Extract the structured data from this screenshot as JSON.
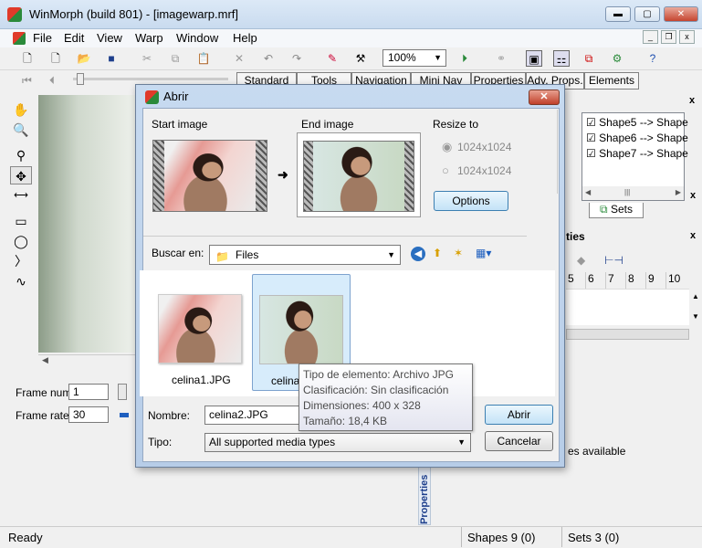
{
  "window": {
    "title": "WinMorph (build 801) - [imagewarp.mrf]",
    "min": "▬",
    "max": "▢",
    "close": "✕"
  },
  "menu": [
    "File",
    "Edit",
    "View",
    "Warp",
    "Window",
    "Help"
  ],
  "mdi": {
    "min": "_",
    "restore": "❐",
    "close": "x"
  },
  "toolbar": {
    "zoom": "100%"
  },
  "tabs": [
    "Standard",
    "Tools",
    "Navigation",
    "Mini Nav",
    "Properties",
    "Adv. Props.",
    "Elements"
  ],
  "left": {
    "frame_num_label": "Frame num",
    "frame_num_value": "1",
    "frame_rate_label": "Frame rate",
    "frame_rate_value": "30"
  },
  "shapes": [
    "Shape5 --> Shape",
    "Shape6 --> Shape",
    "Shape7 --> Shape"
  ],
  "sets_tab": "Sets",
  "panel2": {
    "title": "ties",
    "ticks": [
      "5",
      "6",
      "7",
      "8",
      "9",
      "10"
    ]
  },
  "status": {
    "ready": "Ready",
    "shapes": "Shapes 9 (0)",
    "sets": "Sets 3 (0)",
    "available": "es available"
  },
  "properties_vertical": "Properties",
  "dialog": {
    "title": "Abrir",
    "start_label": "Start image",
    "end_label": "End image",
    "resize_label": "Resize to",
    "resize_opt1": "1024x1024",
    "resize_opt2": "1024x1024",
    "options_btn": "Options",
    "lookin_label": "Buscar en:",
    "lookin_value": "Files",
    "files": [
      {
        "name": "celina1.JPG"
      },
      {
        "name": "celina2.JPG"
      }
    ],
    "file2_visible": "celina",
    "name_label": "Nombre:",
    "name_value": "celina2.JPG",
    "type_label": "Tipo:",
    "type_value": "All supported media types",
    "open_btn": "Abrir",
    "cancel_btn": "Cancelar",
    "tooltip": [
      "Tipo de elemento: Archivo JPG",
      "Clasificación: Sin clasificación",
      "Dimensiones: 400 x 328",
      "Tamaño: 18,4 KB"
    ]
  },
  "colors": {
    "accent": "#3c7fb1",
    "close": "#c5452f"
  }
}
